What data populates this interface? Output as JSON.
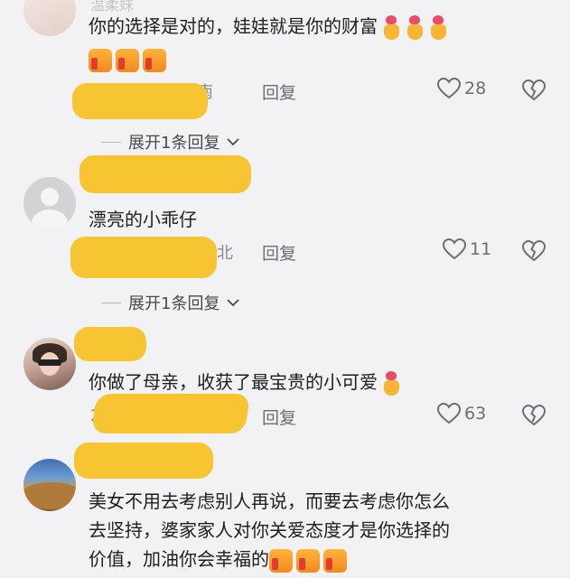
{
  "comments": [
    {
      "text": "你的选择是对的，娃娃就是你的财富",
      "meta_region": "湖南",
      "reply_label": "回复",
      "likes": "28",
      "expand_label": "展开1条回复",
      "name_ghost": "温柔妹"
    },
    {
      "text": "漂亮的小乖仔",
      "meta_region": "北",
      "reply_label": "回复",
      "likes": "11",
      "expand_label": "展开1条回复"
    },
    {
      "text": "你做了母亲，收获了最宝贵的小可爱",
      "meta_region": "2",
      "reply_label": "回复",
      "likes": "63"
    },
    {
      "text_lines": [
        "美女不用去考虑别人再说，而要去考虑你怎么",
        "去坚持，婆家家人对你关爱态度才是你选择的",
        "价值，加油你会幸福的"
      ]
    }
  ],
  "colors": {
    "background": "#f2f2f4",
    "censor": "#f7c531",
    "meta": "#8a8a8e"
  },
  "icons": [
    "heart-outline-icon",
    "broken-heart-icon",
    "chevron-down-icon",
    "thumbs-up-emoji",
    "heart-finger-emoji"
  ]
}
